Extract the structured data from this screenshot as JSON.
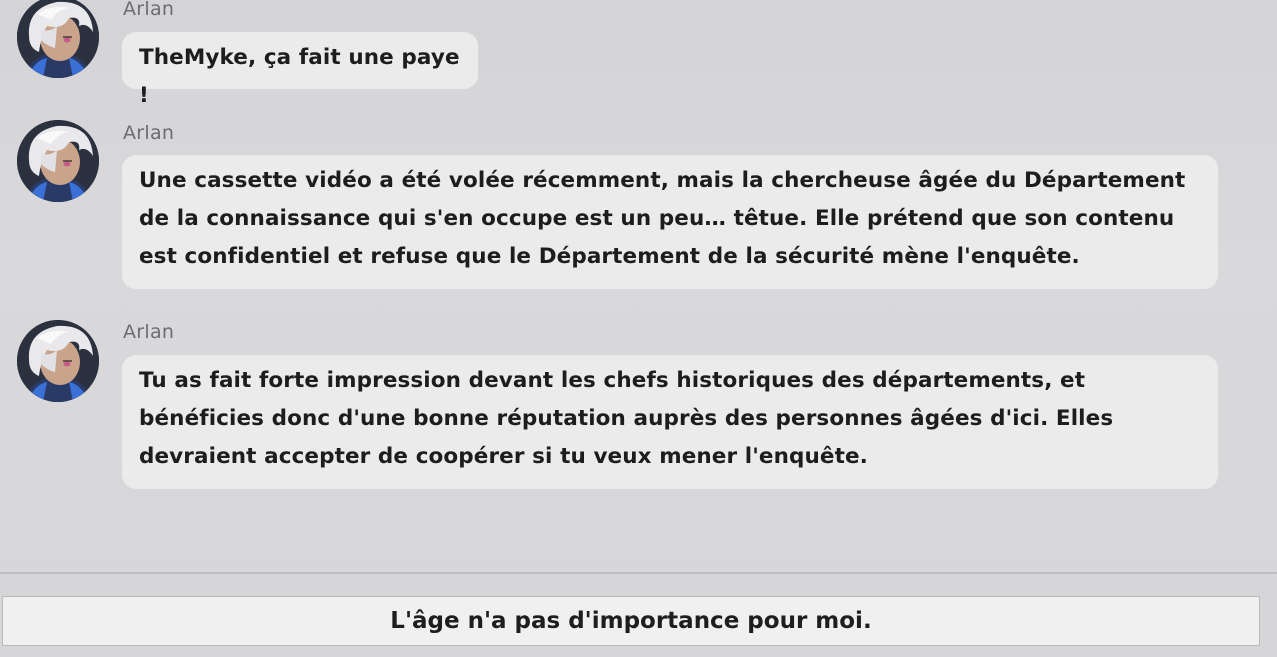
{
  "messages": [
    {
      "sender": "Arlan",
      "text": "TheMyke, ça fait une paye !"
    },
    {
      "sender": "Arlan",
      "text": "Une cassette vidéo a été volée récemment, mais la chercheuse âgée du Département de la connaissance qui s'en occupe est un peu… têtue. Elle prétend que son contenu est confidentiel et refuse que le Département de la sécurité mène l'enquête."
    },
    {
      "sender": "Arlan",
      "text": "Tu as fait forte impression devant les chefs historiques des départements, et bénéficies donc d'une bonne réputation auprès des personnes âgées d'ici. Elles devraient accepter de coopérer si tu veux mener l'enquête."
    }
  ],
  "reply_option": {
    "label": "L'âge n'a pas d'importance pour moi."
  },
  "avatar_icon": "character-portrait-icon"
}
